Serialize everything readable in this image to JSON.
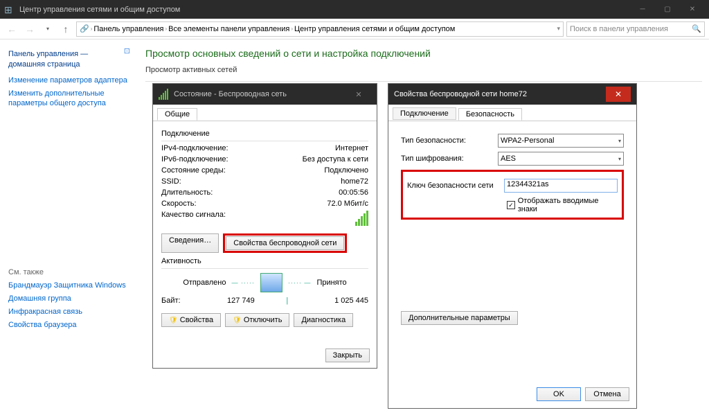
{
  "titlebar": {
    "title": "Центр управления сетями и общим доступом"
  },
  "nav": {
    "breadcrumb": [
      "Панель управления",
      "Все элементы панели управления",
      "Центр управления сетями и общим доступом"
    ],
    "search_placeholder": "Поиск в панели управления"
  },
  "sidebar": {
    "home": "Панель управления — домашняя страница",
    "links": [
      "Изменение параметров адаптера",
      "Изменить дополнительные параметры общего доступа"
    ],
    "see_also_label": "См. также",
    "see_also": [
      "Брандмауэр Защитника Windows",
      "Домашняя группа",
      "Инфракрасная связь",
      "Свойства браузера"
    ]
  },
  "content": {
    "heading": "Просмотр основных сведений о сети и настройка подключений",
    "subheading": "Просмотр активных сетей"
  },
  "dlg1": {
    "title": "Состояние - Беспроводная сеть",
    "tab": "Общие",
    "group1": "Подключение",
    "rows1": [
      [
        "IPv4-подключение:",
        "Интернет"
      ],
      [
        "IPv6-подключение:",
        "Без доступа к сети"
      ],
      [
        "Состояние среды:",
        "Подключено"
      ],
      [
        "SSID:",
        "home72"
      ],
      [
        "Длительность:",
        "00:05:56"
      ],
      [
        "Скорость:",
        "72.0 Мбит/с"
      ],
      [
        "Качество сигнала:",
        ""
      ]
    ],
    "btn_details": "Сведения…",
    "btn_wifi_props": "Свойства беспроводной сети",
    "group2": "Активность",
    "sent_label": "Отправлено",
    "recv_label": "Принято",
    "bytes_label": "Байт:",
    "bytes_sent": "127 749",
    "bytes_recv": "1 025 445",
    "btn_props": "Свойства",
    "btn_disable": "Отключить",
    "btn_diag": "Диагностика",
    "btn_close": "Закрыть"
  },
  "dlg2": {
    "title": "Свойства беспроводной сети home72",
    "tab1": "Подключение",
    "tab2": "Безопасность",
    "security_type_label": "Тип безопасности:",
    "security_type_value": "WPA2-Personal",
    "encryption_label": "Тип шифрования:",
    "encryption_value": "AES",
    "key_label": "Ключ безопасности сети",
    "key_value": "12344321as",
    "show_chars": "Отображать вводимые знаки",
    "advanced": "Дополнительные параметры",
    "ok": "OK",
    "cancel": "Отмена"
  }
}
